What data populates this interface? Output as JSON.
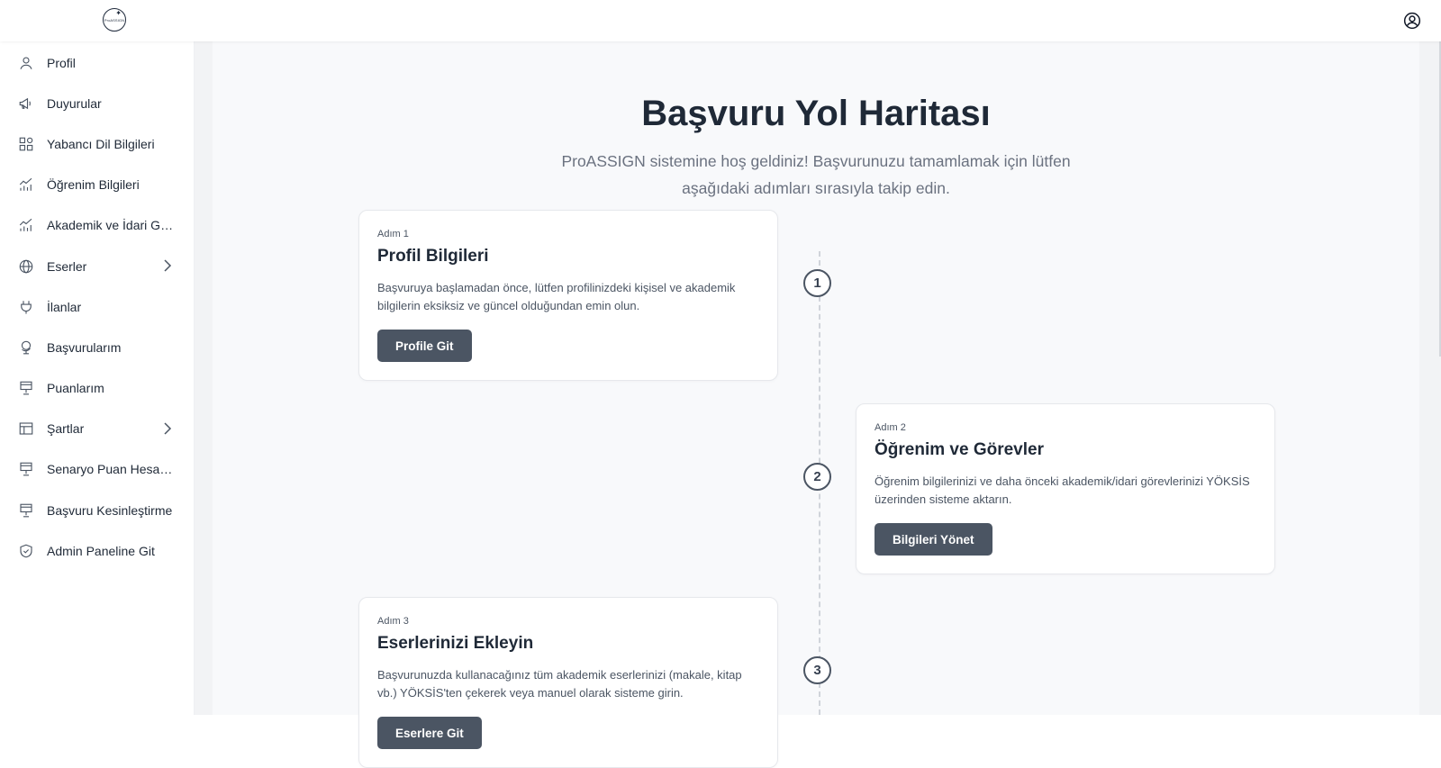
{
  "header": {
    "logo_text": "ProASSIGN"
  },
  "sidebar": {
    "items": [
      {
        "label": "Profil",
        "icon": "user-icon",
        "has_submenu": false
      },
      {
        "label": "Duyurular",
        "icon": "megaphone-icon",
        "has_submenu": false
      },
      {
        "label": "Yabancı Dil Bilgileri",
        "icon": "grid-icon",
        "has_submenu": false
      },
      {
        "label": "Öğrenim Bilgileri",
        "icon": "chart-icon",
        "has_submenu": false
      },
      {
        "label": "Akademik ve İdari Görevler",
        "icon": "chart-icon",
        "has_submenu": false
      },
      {
        "label": "Eserler",
        "icon": "globe-icon",
        "has_submenu": true
      },
      {
        "label": "İlanlar",
        "icon": "plug-icon",
        "has_submenu": false
      },
      {
        "label": "Başvurularım",
        "icon": "globe-stand-icon",
        "has_submenu": false
      },
      {
        "label": "Puanlarım",
        "icon": "monitor-icon",
        "has_submenu": false
      },
      {
        "label": "Şartlar",
        "icon": "table-icon",
        "has_submenu": true
      },
      {
        "label": "Senaryo Puan Hesaplama",
        "icon": "monitor-icon",
        "has_submenu": false
      },
      {
        "label": "Başvuru Kesinleştirme",
        "icon": "monitor-icon",
        "has_submenu": false
      },
      {
        "label": "Admin Paneline Git",
        "icon": "shield-icon",
        "has_submenu": false
      }
    ]
  },
  "main": {
    "title": "Başvuru Yol Haritası",
    "subtitle": "ProASSIGN sistemine hoş geldiniz! Başvurunuzu tamamlamak için lütfen aşağıdaki adımları sırasıyla takip edin.",
    "steps": [
      {
        "number": "1",
        "step_label": "Adım 1",
        "title": "Profil Bilgileri",
        "description": "Başvuruya başlamadan önce, lütfen profilinizdeki kişisel ve akademik bilgilerin eksiksiz ve güncel olduğundan emin olun.",
        "button_label": "Profile Git"
      },
      {
        "number": "2",
        "step_label": "Adım 2",
        "title": "Öğrenim ve Görevler",
        "description": "Öğrenim bilgilerinizi ve daha önceki akademik/idari görevlerinizi YÖKSİS üzerinden sisteme aktarın.",
        "button_label": "Bilgileri Yönet"
      },
      {
        "number": "3",
        "step_label": "Adım 3",
        "title": "Eserlerinizi Ekleyin",
        "description": "Başvurunuzda kullanacağınız tüm akademik eserlerinizi (makale, kitap vb.) YÖKSİS'ten çekerek veya manuel olarak sisteme girin.",
        "button_label": "Eserlere Git"
      }
    ]
  },
  "colors": {
    "button_bg": "#4b5563",
    "panel_bg": "#f8f9fb",
    "text_dark": "#1f2937",
    "text_muted": "#6b7280"
  }
}
